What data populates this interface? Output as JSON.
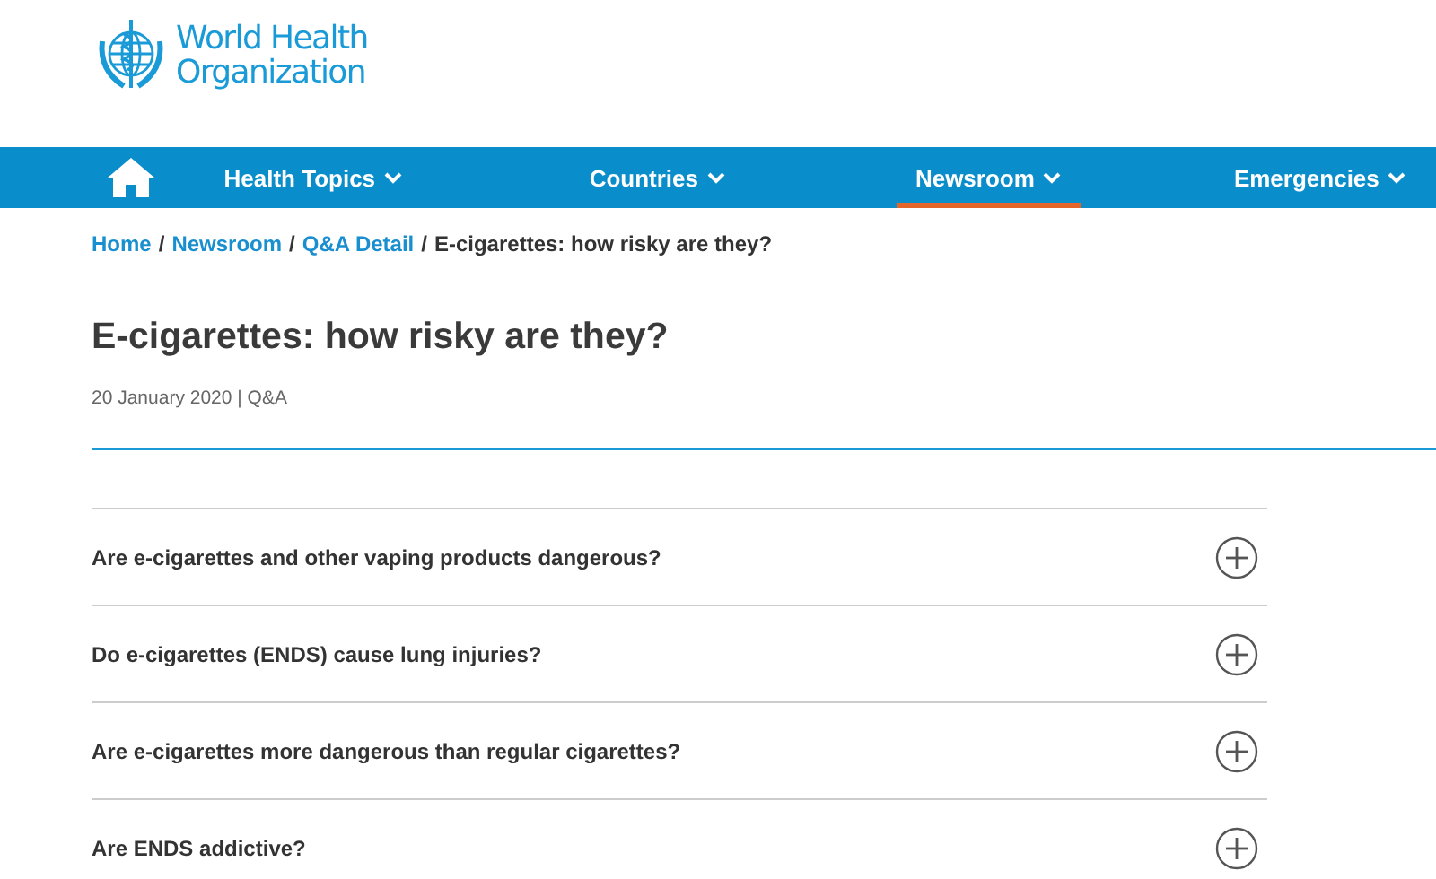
{
  "logo": {
    "lines": [
      "World Health",
      "Organization"
    ]
  },
  "nav": {
    "items": [
      {
        "label": "Health Topics",
        "selected": false
      },
      {
        "label": "Countries",
        "selected": false
      },
      {
        "label": "Newsroom",
        "selected": true
      },
      {
        "label": "Emergencies",
        "selected": false
      }
    ]
  },
  "breadcrumb": {
    "separator": "/",
    "items": [
      {
        "label": "Home",
        "kind": "link"
      },
      {
        "label": "Newsroom",
        "kind": "link"
      },
      {
        "label": "Q&A Detail",
        "kind": "link"
      },
      {
        "label": "E-cigarettes: how risky are they?",
        "kind": "current"
      }
    ]
  },
  "title": "E-cigarettes: how risky are they?",
  "meta": "20 January 2020 | Q&A",
  "questions": [
    {
      "text": "Are e-cigarettes and other vaping products dangerous?",
      "expanded": false
    },
    {
      "text": "Do e-cigarettes (ENDS) cause lung injuries?",
      "expanded": false
    },
    {
      "text": "Are e-cigarettes more dangerous than regular cigarettes?",
      "expanded": false
    },
    {
      "text": "Are ENDS addictive?",
      "expanded": false
    }
  ]
}
